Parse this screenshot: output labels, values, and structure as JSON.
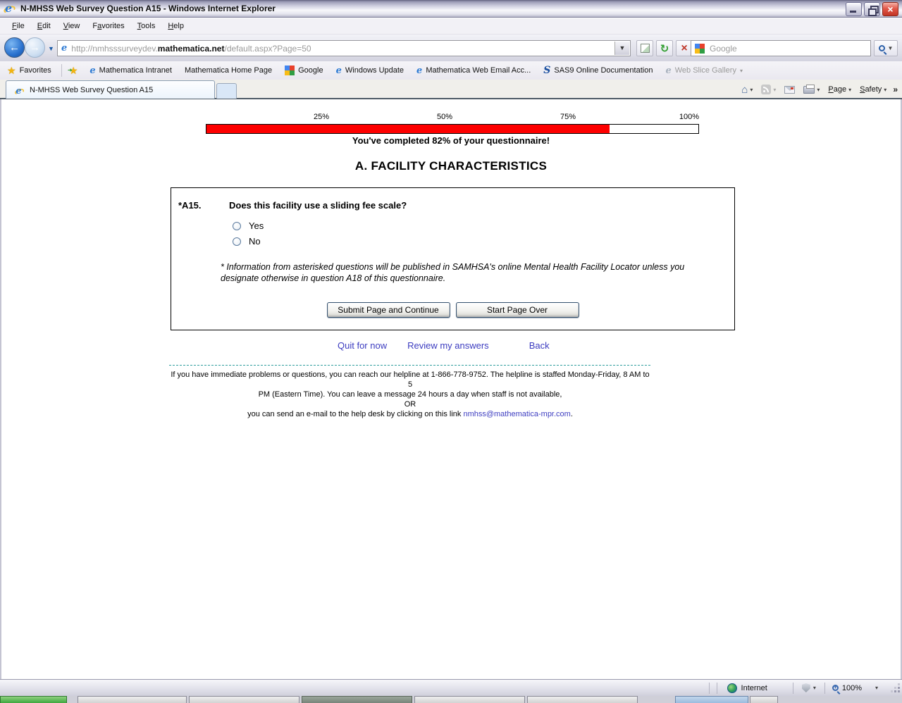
{
  "window": {
    "title": "N-MHSS Web Survey Question A15 - Windows Internet Explorer",
    "close_glyph": "×"
  },
  "menu": {
    "items": [
      {
        "pre": "",
        "accel": "F",
        "post": "ile"
      },
      {
        "pre": "",
        "accel": "E",
        "post": "dit"
      },
      {
        "pre": "",
        "accel": "V",
        "post": "iew"
      },
      {
        "pre": "F",
        "accel": "a",
        "post": "vorites"
      },
      {
        "pre": "",
        "accel": "T",
        "post": "ools"
      },
      {
        "pre": "",
        "accel": "H",
        "post": "elp"
      }
    ]
  },
  "navigation": {
    "back_glyph": "←",
    "forward_glyph": "→",
    "caret_glyph": "▼",
    "url_prefix": "http://nmhsssurveydev.",
    "url_host": "mathematica.net",
    "url_path": "/default.aspx?Page=50",
    "search_placeholder": "Google",
    "refresh_glyph": "↻",
    "stop_glyph": "×"
  },
  "favorites_bar": {
    "label": "Favorites",
    "items": [
      {
        "label": "Mathematica Intranet",
        "icon": "ie-icon"
      },
      {
        "label": "Mathematica Home Page",
        "icon": "none"
      },
      {
        "label": "Google",
        "icon": "google-icon"
      },
      {
        "label": "Windows Update",
        "icon": "ie-icon"
      },
      {
        "label": "Mathematica Web Email Acc...",
        "icon": "ie-icon"
      },
      {
        "label": "SAS9 Online Documentation",
        "icon": "sas-icon"
      },
      {
        "label": "Web Slice Gallery",
        "icon": "ie-icon-gray",
        "muted": true,
        "caret": "▾"
      }
    ]
  },
  "tabs": {
    "active_title": "N-MHSS Web Survey Question A15"
  },
  "command_bar": {
    "home_caret": "▾",
    "feed_caret": "▾",
    "print_caret": "▾",
    "page_label": "Page",
    "page_caret": "▾",
    "safety_label": "Safety",
    "safety_caret": "▾",
    "overflow": "»"
  },
  "survey": {
    "progress": {
      "tick_labels": [
        "25%",
        "50%",
        "75%",
        "100%"
      ],
      "percent": 82,
      "fill_color": "#fe0000",
      "message": "You've completed 82% of your questionnaire!"
    },
    "section_title": "A. FACILITY CHARACTERISTICS",
    "question": {
      "number": "*A15.",
      "text": "Does this facility use a sliding fee scale?",
      "options": [
        "Yes",
        "No"
      ],
      "note_line1": "* Information from asterisked questions will be published in SAMHSA's online Mental Health Facility Locator unless you",
      "note_line2": "designate otherwise in question A18 of this questionnaire."
    },
    "buttons": {
      "submit": "Submit Page and Continue",
      "start_over": "Start Page Over"
    },
    "footer_links": [
      "Quit for now",
      "Review my answers",
      "Back"
    ],
    "help": {
      "line1": "If you have immediate problems or questions, you can reach our helpline at 1-866-778-9752. The helpline is staffed Monday-Friday, 8 AM to 5",
      "line2": "PM (Eastern Time). You can leave a message 24 hours a day when staff is not available,",
      "or": "OR",
      "line3_prefix": "you can send an e-mail to the help desk by clicking on this link ",
      "email": "nmhss@mathematica-mpr.com",
      "line3_suffix": "."
    }
  },
  "status_bar": {
    "zone": "Internet",
    "zoom": "100%",
    "carets": "▾"
  }
}
